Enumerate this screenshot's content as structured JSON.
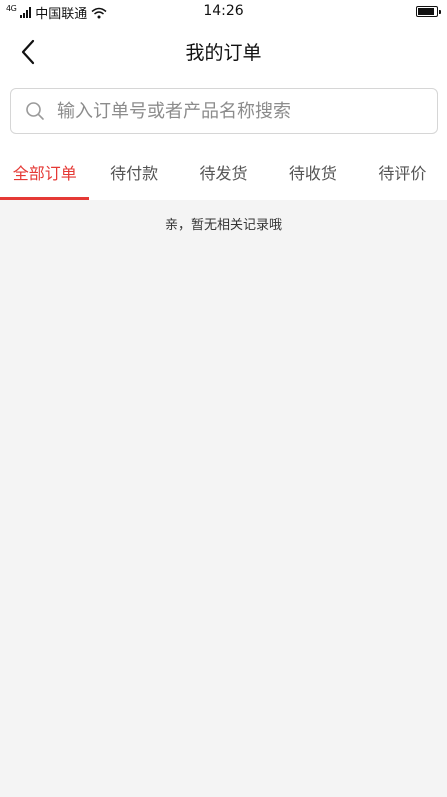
{
  "status_bar": {
    "network": "4G",
    "carrier": "中国联通",
    "time": "14:26",
    "icons": [
      "signal-icon",
      "wifi-icon",
      "battery-icon"
    ]
  },
  "header": {
    "title": "我的订单",
    "back_icon": "chevron-left-icon"
  },
  "search": {
    "placeholder": "输入订单号或者产品名称搜索",
    "value": "",
    "icon": "search-icon"
  },
  "tabs": [
    {
      "label": "全部订单",
      "active": true
    },
    {
      "label": "待付款",
      "active": false
    },
    {
      "label": "待发货",
      "active": false
    },
    {
      "label": "待收货",
      "active": false
    },
    {
      "label": "待评价",
      "active": false
    }
  ],
  "empty_state": {
    "message": "亲，暂无相关记录哦"
  },
  "colors": {
    "accent": "#e53935",
    "background": "#f4f4f4",
    "surface": "#ffffff"
  }
}
